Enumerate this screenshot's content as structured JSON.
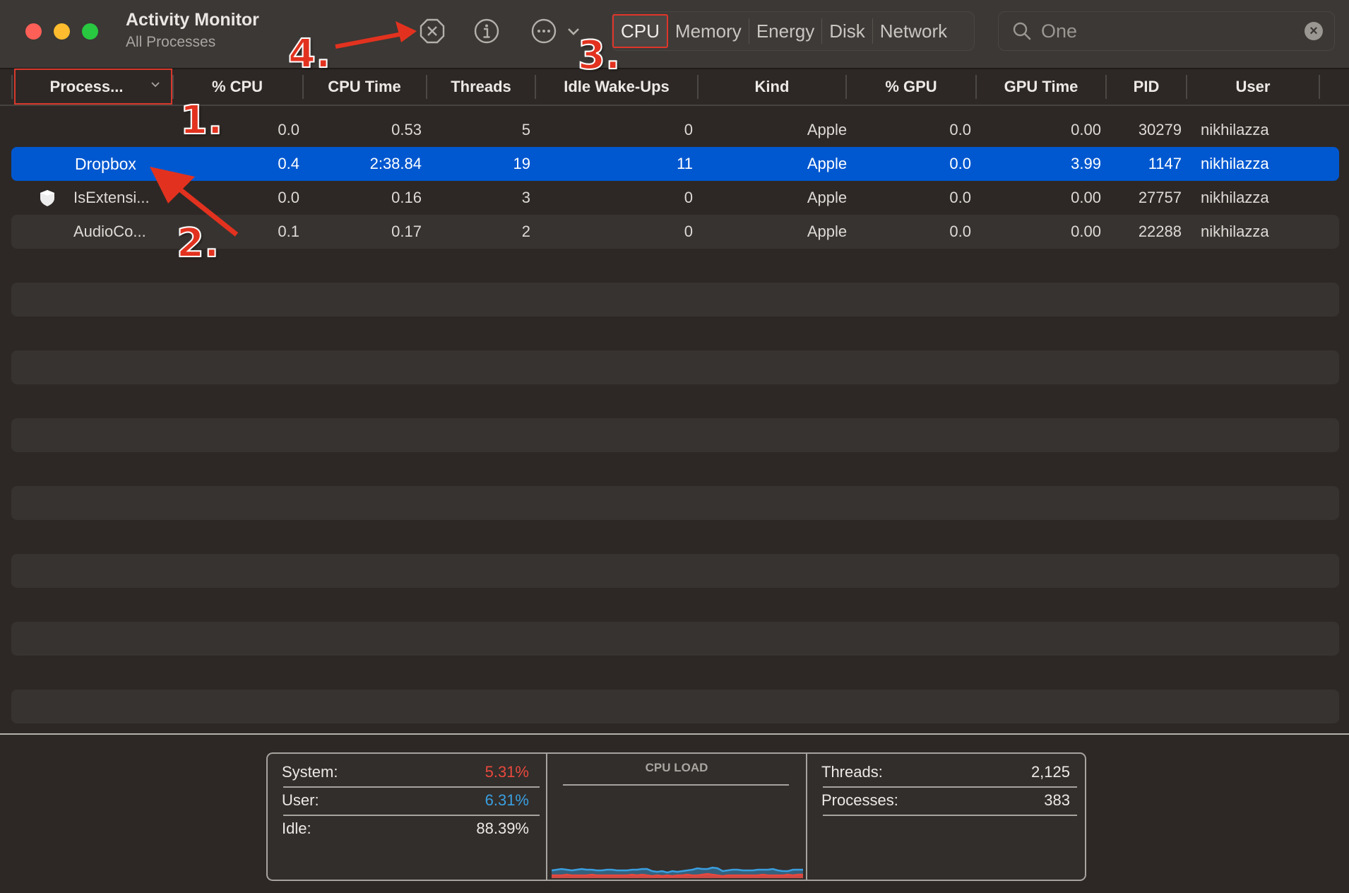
{
  "window": {
    "title": "Activity Monitor",
    "subtitle": "All Processes"
  },
  "toolbar": {
    "stop_icon": "stop-process-icon",
    "info_icon": "info-icon",
    "more_icon": "ellipsis-circle-icon",
    "tabs": [
      {
        "label": "CPU",
        "selected": true
      },
      {
        "label": "Memory",
        "selected": false
      },
      {
        "label": "Energy",
        "selected": false
      },
      {
        "label": "Disk",
        "selected": false
      },
      {
        "label": "Network",
        "selected": false
      }
    ],
    "search": {
      "value": "One",
      "icon": "search-icon",
      "clear_icon": "clear-icon"
    }
  },
  "table": {
    "columns": [
      "Process...",
      "% CPU",
      "CPU Time",
      "Threads",
      "Idle Wake-Ups",
      "Kind",
      "% GPU",
      "GPU Time",
      "PID",
      "User"
    ],
    "rows": [
      {
        "name": "",
        "cpu": "0.0",
        "cpu_time": "0.53",
        "threads": "5",
        "idle_wakeups": "0",
        "kind": "Apple",
        "gpu": "0.0",
        "gpu_time": "0.00",
        "pid": "30279",
        "user": "nikhilazza",
        "selected": false
      },
      {
        "name": "Dropbox",
        "cpu": "0.4",
        "cpu_time": "2:38.84",
        "threads": "19",
        "idle_wakeups": "11",
        "kind": "Apple",
        "gpu": "0.0",
        "gpu_time": "3.99",
        "pid": "1147",
        "user": "nikhilazza",
        "selected": true
      },
      {
        "name": "IsExtensi...",
        "icon": "shield-icon",
        "cpu": "0.0",
        "cpu_time": "0.16",
        "threads": "3",
        "idle_wakeups": "0",
        "kind": "Apple",
        "gpu": "0.0",
        "gpu_time": "0.00",
        "pid": "27757",
        "user": "nikhilazza",
        "selected": false
      },
      {
        "name": "AudioCo...",
        "cpu": "0.1",
        "cpu_time": "0.17",
        "threads": "2",
        "idle_wakeups": "0",
        "kind": "Apple",
        "gpu": "0.0",
        "gpu_time": "0.00",
        "pid": "22288",
        "user": "nikhilazza",
        "selected": false
      }
    ]
  },
  "footer": {
    "cpu_stats": [
      {
        "label": "System:",
        "value": "5.31%",
        "color": "#e8483d"
      },
      {
        "label": "User:",
        "value": "6.31%",
        "color": "#3a9fe0"
      },
      {
        "label": "Idle:",
        "value": "88.39%",
        "color": "#ece9e6"
      }
    ],
    "chart_title": "CPU LOAD",
    "counts": [
      {
        "label": "Threads:",
        "value": "2,125"
      },
      {
        "label": "Processes:",
        "value": "383"
      }
    ],
    "cpu_load_history": {
      "system": [
        4,
        4,
        4,
        5,
        4,
        4,
        4,
        4,
        5,
        4,
        4,
        4,
        4,
        4,
        4,
        4,
        5,
        4,
        5,
        4,
        3,
        4,
        3,
        4,
        3,
        4,
        4,
        5,
        4,
        4,
        5,
        6,
        5,
        4,
        3,
        4,
        4,
        4,
        4,
        4,
        4,
        4,
        5,
        4,
        4,
        4,
        4,
        5,
        4,
        5,
        5
      ],
      "user": [
        11,
        12,
        13,
        12,
        11,
        12,
        13,
        12,
        12,
        11,
        11,
        12,
        12,
        11,
        11,
        11,
        12,
        12,
        13,
        13,
        10,
        9,
        10,
        8,
        10,
        9,
        10,
        11,
        12,
        14,
        13,
        13,
        15,
        14,
        10,
        11,
        12,
        12,
        11,
        11,
        11,
        12,
        12,
        12,
        13,
        11,
        10,
        10,
        12,
        12,
        12
      ],
      "system_color": "#e8483d",
      "user_color": "#3a9fe0"
    }
  },
  "annotations": [
    {
      "label": "1.",
      "color": "#e2321f"
    },
    {
      "label": "2.",
      "color": "#e2321f"
    },
    {
      "label": "3.",
      "color": "#e2321f"
    },
    {
      "label": "4.",
      "color": "#e2321f"
    }
  ]
}
